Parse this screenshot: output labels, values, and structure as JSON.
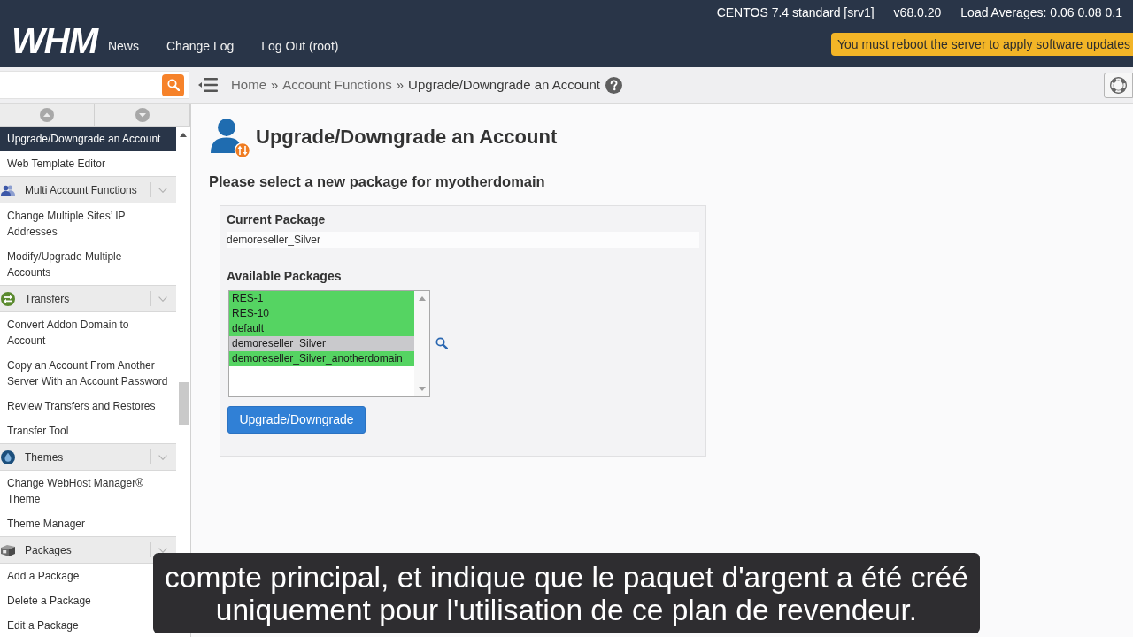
{
  "top_bar": {
    "server_info": [
      "CENTOS 7.4 standard [srv1]",
      "v68.0.20",
      "Load Averages: 0.06 0.08 0.1"
    ],
    "logo": "WHM",
    "nav": [
      "News",
      "Change Log",
      "Log Out (root)"
    ],
    "notice": "You must reboot the server to apply software updates"
  },
  "breadcrumb": [
    {
      "label": "Home",
      "separator": "»"
    },
    {
      "label": "Account Functions",
      "separator": "»"
    },
    {
      "label": "Upgrade/Downgrade an Account"
    }
  ],
  "sidebar": {
    "items": [
      {
        "label": "Upgrade/Downgrade an Account",
        "selected": true
      },
      {
        "label": "Web Template Editor",
        "selected": false
      }
    ],
    "sections": [
      {
        "title": "Multi Account Functions",
        "children": [
          {
            "label": "Change Multiple Sites’ IP\nAddresses",
            "selected": false
          },
          {
            "label": "Modify/Upgrade Multiple\nAccounts",
            "selected": false
          }
        ]
      },
      {
        "title": "Transfers",
        "children": [
          {
            "label": "Convert Addon Domain to\nAccount",
            "selected": false
          },
          {
            "label": "Copy an Account From Another\nServer With an Account Password",
            "selected": false
          },
          {
            "label": "Review Transfers and Restores",
            "selected": false
          },
          {
            "label": "Transfer Tool",
            "selected": false
          }
        ]
      },
      {
        "title": "Themes",
        "children": [
          {
            "label": "Change WebHost Manager®\nTheme",
            "selected": false
          },
          {
            "label": "Theme Manager",
            "selected": false
          }
        ]
      },
      {
        "title": "Packages",
        "children": [
          {
            "label": "Add a Package",
            "selected": false
          },
          {
            "label": "Delete a Package",
            "selected": false
          },
          {
            "label": "Edit a Package",
            "selected": false
          }
        ]
      }
    ]
  },
  "page": {
    "title": "Upgrade/Downgrade an Account",
    "prompt": "Please select a new package for myotherdomain",
    "current_package": {
      "label": "Current Package",
      "value": "demoreseller_Silver"
    },
    "available_packages": {
      "label": "Available Packages",
      "options": [
        {
          "label": "RES-1",
          "color": "#55d462"
        },
        {
          "label": "RES-10",
          "color": "#55d462"
        },
        {
          "label": "default",
          "color": "#55d462"
        },
        {
          "label": "demoreseller_Silver",
          "color": "#c9c9cc"
        },
        {
          "label": "demoreseller_Silver_anotherdomain",
          "color": "#55d462"
        }
      ]
    },
    "submit": "Upgrade/Downgrade"
  },
  "caption": "compte principal, et indique que le paquet d'argent a été créé\nuniquement pour l'utilisation de ce plan de revendeur."
}
